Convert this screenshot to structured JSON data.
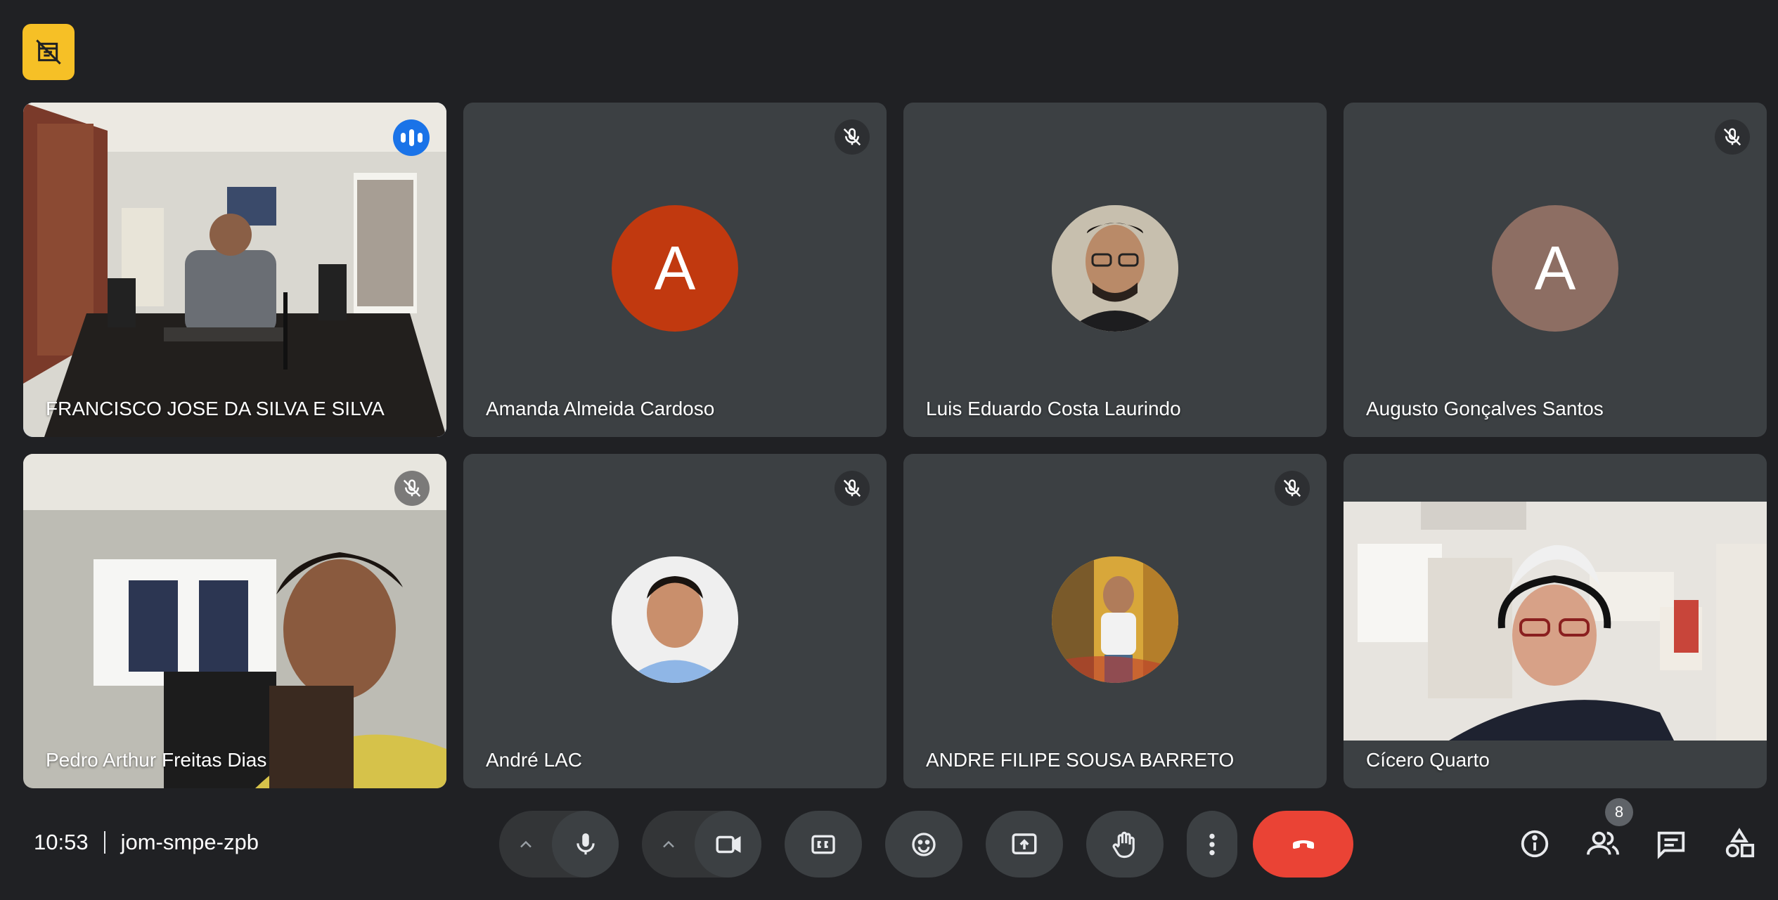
{
  "meeting": {
    "time": "10:53",
    "code": "jom-smpe-zpb",
    "participant_count": "8"
  },
  "participants": [
    {
      "name": "FRANCISCO JOSE DA SILVA E SILVA",
      "muted": false,
      "speaking": true,
      "video": true
    },
    {
      "name": "Amanda Almeida Cardoso",
      "muted": true,
      "avatar_letter": "A",
      "avatar_color": "#c1390f"
    },
    {
      "name": "Luis Eduardo Costa Laurindo",
      "muted": false,
      "avatar_photo": true
    },
    {
      "name": "Augusto Gonçalves Santos",
      "muted": true,
      "avatar_letter": "A",
      "avatar_color": "#8d6e63"
    },
    {
      "name": "Pedro Arthur Freitas Dias",
      "muted": true,
      "video": true
    },
    {
      "name": "André LAC",
      "muted": true,
      "avatar_photo": true
    },
    {
      "name": "ANDRE FILIPE SOUSA BARRETO",
      "muted": true,
      "avatar_photo": true
    },
    {
      "name": "Cícero Quarto",
      "muted": false,
      "video": true
    }
  ],
  "colors": {
    "background": "#202124",
    "tile": "#3c4043",
    "speaking_outline": "#8ab4f8",
    "end_call": "#ea4335",
    "recording_badge": "#f6c026"
  },
  "controls": {
    "icons": [
      "recording-off-icon",
      "mic-icon",
      "camera-icon",
      "captions-icon",
      "emoji-icon",
      "present-icon",
      "raise-hand-icon",
      "more-options-icon",
      "end-call-icon",
      "info-icon",
      "people-icon",
      "chat-icon",
      "activities-icon"
    ]
  }
}
